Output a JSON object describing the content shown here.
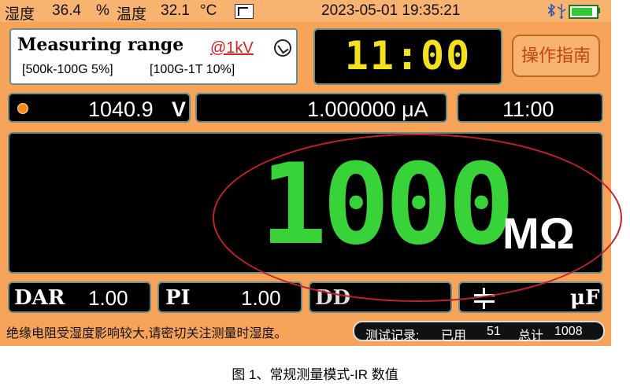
{
  "status_bar": {
    "humidity_label": "湿度",
    "humidity_value": "36.4",
    "humidity_unit": "%",
    "temperature_label": "温度",
    "temperature_value": "32.1",
    "temperature_unit": "°C",
    "datetime": "2023-05-01 19:35:21",
    "icons": [
      "waveform-icon",
      "bluetooth-icon",
      "usb-icon",
      "battery-icon"
    ]
  },
  "range_box": {
    "title": "Measuring range",
    "voltage": "@1kV",
    "spec1": "[500k-100G  5%]",
    "spec2": "[100G-1T  10%]"
  },
  "timer": {
    "value": "11:00"
  },
  "guide_button": {
    "label": "操作指南"
  },
  "readouts": {
    "voltage": "1040.9",
    "voltage_unit": "V",
    "current": "1.000000 μA",
    "elapsed": "11:00"
  },
  "main": {
    "reading": "1000",
    "unit": "MΩ"
  },
  "bottom": {
    "dar_label": "DAR",
    "dar_value": "1.00",
    "pi_label": "PI",
    "pi_value": "1.00",
    "dd_label": "DD",
    "cap_unit": "μF"
  },
  "footer": {
    "notice": "绝缘电阻受湿度影响较大,请密切关注测量时湿度。",
    "records_label": "测试记录:",
    "used_label": "已用",
    "used_value": "51",
    "total_label": "总计",
    "total_value": "1008"
  },
  "caption": "图 1、常规测量模式-IR 数值",
  "colors": {
    "frame": "#f7a35a",
    "display_green": "#37d339",
    "timer_yellow": "#f4e01c",
    "highlight": "#c2202a",
    "link_red": "#d62020"
  }
}
